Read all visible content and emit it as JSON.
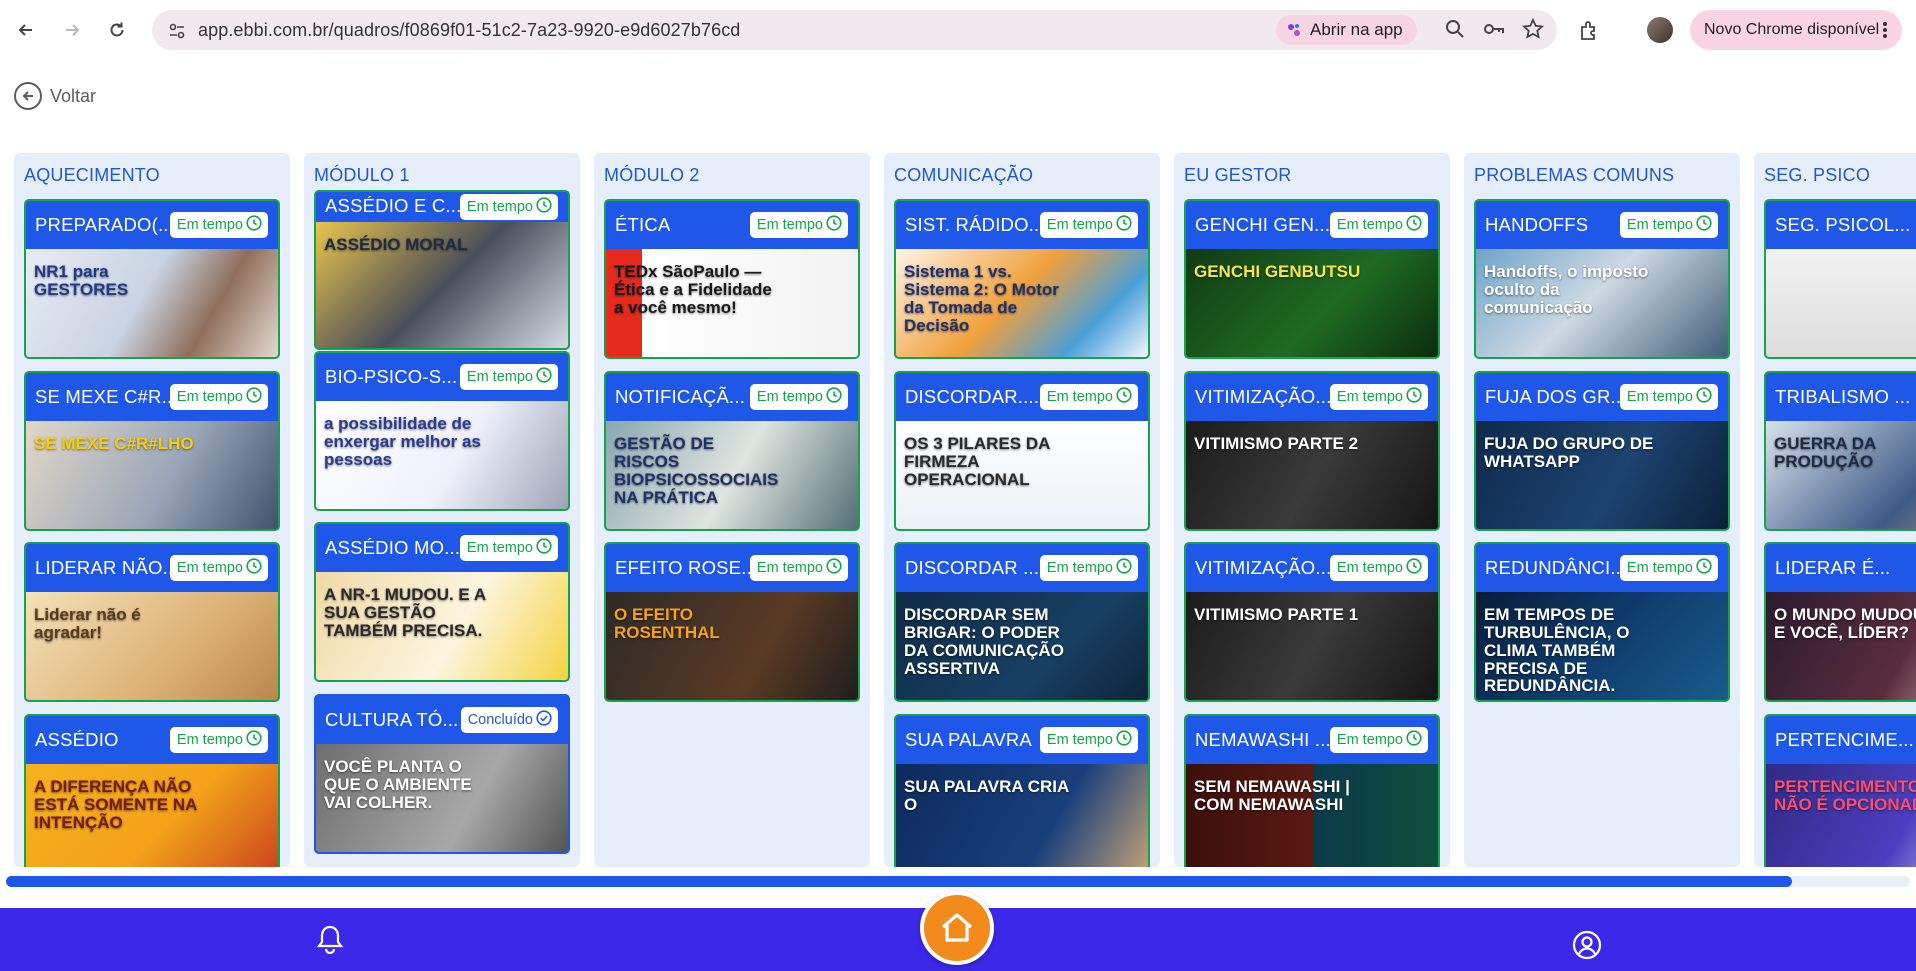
{
  "browser": {
    "url": "app.ebbi.com.br/quadros/f0869f01-51c2-7a23-9920-e9d6027b76cd",
    "open_app_label": "Abrir na app",
    "update_label": "Novo Chrome disponível"
  },
  "app": {
    "back_label": "Voltar"
  },
  "columns": [
    {
      "title": "AQUECIMENTO",
      "cards": [
        {
          "title": "PREPARADO(...",
          "status": "Em tempo",
          "thumb_text": "NR1 para GESTORES"
        },
        {
          "title": "SE MEXE C#R...",
          "status": "Em tempo",
          "thumb_text": "SE MEXE C#R#LHO"
        },
        {
          "title": "LIDERAR NÃO...",
          "status": "Em tempo",
          "thumb_text": "Liderar não é agradar!"
        },
        {
          "title": "ASSÉDIO",
          "status": "Em tempo",
          "thumb_text": "A DIFERENÇA NÃO ESTÁ SOMENTE NA INTENÇÃO"
        }
      ]
    },
    {
      "title": "MÓDULO 1",
      "cards": [
        {
          "title": "ASSÉDIO E C...",
          "status": "Em tempo",
          "thumb_text": "ASSÉDIO MORAL"
        },
        {
          "title": "BIO-PSICO-S...",
          "status": "Em tempo",
          "thumb_text": "a possibilidade de enxergar melhor as pessoas"
        },
        {
          "title": "ASSÉDIO MO...",
          "status": "Em tempo",
          "thumb_text": "A NR-1 MUDOU. E A SUA GESTÃO TAMBÉM PRECISA."
        },
        {
          "title": "CULTURA TÓ...",
          "status": "Concluído",
          "thumb_text": "VOCÊ PLANTA O QUE O AMBIENTE VAI COLHER."
        }
      ]
    },
    {
      "title": "MÓDULO 2",
      "cards": [
        {
          "title": "ÉTICA",
          "status": "Em tempo",
          "thumb_text": "TEDx SãoPaulo — Ética e a Fidelidade a você mesmo!"
        },
        {
          "title": "NOTIFICAÇÃ...",
          "status": "Em tempo",
          "thumb_text": "GESTÃO DE RISCOS BIOPSICOSSOCIAIS NA PRÁTICA"
        },
        {
          "title": "EFEITO ROSE...",
          "status": "Em tempo",
          "thumb_text": "O EFEITO ROSENTHAL"
        }
      ]
    },
    {
      "title": "COMUNICAÇÃO",
      "cards": [
        {
          "title": "SIST. RÁDIDO...",
          "status": "Em tempo",
          "thumb_text": "Sistema 1 vs. Sistema 2: O Motor da Tomada de Decisão"
        },
        {
          "title": "DISCORDAR......",
          "status": "Em tempo",
          "thumb_text": "OS 3 PILARES DA FIRMEZA OPERACIONAL"
        },
        {
          "title": "DISCORDAR .....",
          "status": "Em tempo",
          "thumb_text": "DISCORDAR SEM BRIGAR: O PODER DA COMUNICAÇÃO ASSERTIVA"
        },
        {
          "title": "SUA PALAVRA",
          "status": "Em tempo",
          "thumb_text": "SUA PALAVRA CRIA O"
        }
      ]
    },
    {
      "title": "EU GESTOR",
      "cards": [
        {
          "title": "GENCHI GEN...",
          "status": "Em tempo",
          "thumb_text": "GENCHI GENBUTSU"
        },
        {
          "title": "VITIMIZAÇÃO...",
          "status": "Em tempo",
          "thumb_text": "VITIMISMO PARTE 2"
        },
        {
          "title": "VITIMIZAÇÃO...",
          "status": "Em tempo",
          "thumb_text": "VITIMISMO PARTE 1"
        },
        {
          "title": "NEMAWASHI ...",
          "status": "Em tempo",
          "thumb_text": "SEM NEMAWASHI | COM NEMAWASHI"
        }
      ]
    },
    {
      "title": "PROBLEMAS COMUNS",
      "cards": [
        {
          "title": "HANDOFFS",
          "status": "Em tempo",
          "thumb_text": "Handoffs, o imposto oculto da comunicação"
        },
        {
          "title": "FUJA DOS GR...",
          "status": "Em tempo",
          "thumb_text": "FUJA DO GRUPO DE WHATSAPP"
        },
        {
          "title": "REDUNDÂNCI...",
          "status": "Em tempo",
          "thumb_text": "EM TEMPOS DE TURBULÊNCIA, O CLIMA TAMBÉM PRECISA DE REDUNDÂNCIA."
        }
      ]
    },
    {
      "title": "SEG. PSICO",
      "cards": [
        {
          "title": "SEG. PSICOL...",
          "status": "",
          "thumb_text": ""
        },
        {
          "title": "TRIBALISMO ...",
          "status": "",
          "thumb_text": "GUERRA DA PRODUÇÃO"
        },
        {
          "title": "LIDERAR É...",
          "status": "",
          "thumb_text": "O MUNDO MUDOU! E VOCÊ, LÍDER?"
        },
        {
          "title": "PERTENCIME...",
          "status": "",
          "thumb_text": "PERTENCIMENTO NÃO É OPCIONAL"
        }
      ]
    }
  ],
  "colors": {
    "primary": "#1f57e8",
    "on_time": "#17a34a",
    "column_bg": "#e6eefb",
    "bottom_bar": "#3c28e8",
    "home": "#f38b1c"
  }
}
